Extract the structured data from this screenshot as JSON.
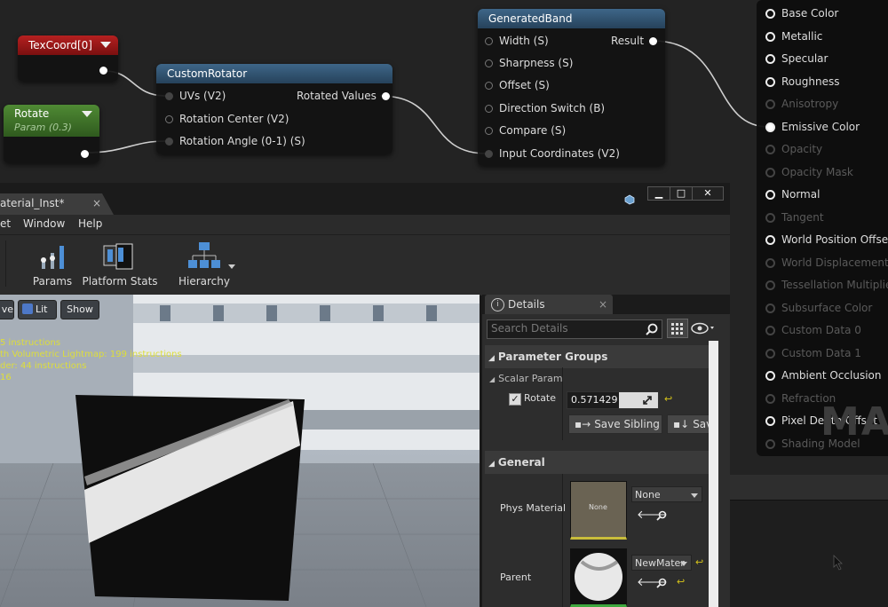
{
  "nodes": {
    "texcoord": {
      "title": "TexCoord[0]"
    },
    "rotate": {
      "title": "Rotate",
      "subtitle": "Param (0.3)"
    },
    "rotator": {
      "title": "CustomRotator",
      "inputs": [
        "UVs (V2)",
        "Rotation Center (V2)",
        "Rotation Angle (0-1) (S)"
      ],
      "output": "Rotated Values"
    },
    "band": {
      "title": "GeneratedBand",
      "inputs": [
        "Width (S)",
        "Sharpness (S)",
        "Offset (S)",
        "Direction Switch (B)",
        "Compare (S)",
        "Input Coordinates (V2)"
      ],
      "output": "Result"
    }
  },
  "result_pins": [
    {
      "label": "Base Color",
      "enabled": true
    },
    {
      "label": "Metallic",
      "enabled": true
    },
    {
      "label": "Specular",
      "enabled": true
    },
    {
      "label": "Roughness",
      "enabled": true
    },
    {
      "label": "Anisotropy",
      "enabled": false
    },
    {
      "label": "Emissive Color",
      "enabled": true
    },
    {
      "label": "Opacity",
      "enabled": false
    },
    {
      "label": "Opacity Mask",
      "enabled": false
    },
    {
      "label": "Normal",
      "enabled": true
    },
    {
      "label": "Tangent",
      "enabled": false
    },
    {
      "label": "World Position Offset",
      "enabled": true
    },
    {
      "label": "World Displacement",
      "enabled": false
    },
    {
      "label": "Tessellation Multiplier",
      "enabled": false
    },
    {
      "label": "Subsurface Color",
      "enabled": false
    },
    {
      "label": "Custom Data 0",
      "enabled": false
    },
    {
      "label": "Custom Data 1",
      "enabled": false
    },
    {
      "label": "Ambient Occlusion",
      "enabled": true
    },
    {
      "label": "Refraction",
      "enabled": false
    },
    {
      "label": "Pixel Depth Offset",
      "enabled": true
    },
    {
      "label": "Shading Model",
      "enabled": false
    }
  ],
  "watermark": "MA",
  "editor": {
    "tab_label": "aterial_Inst*",
    "tab_close": "×",
    "window_buttons": {
      "minimize": "▁",
      "maximize": "□",
      "close": "✕"
    },
    "menu": [
      "et",
      "Window",
      "Help"
    ],
    "toolbar": {
      "params": "Params",
      "platform_stats": "Platform Stats",
      "hierarchy": "Hierarchy"
    },
    "viewport": {
      "buttons": {
        "view": "ve",
        "lit": "Lit",
        "show": "Show"
      },
      "stats": [
        "5 instructions",
        "th Volumetric Lightmap: 199 instructions",
        "der: 44 instructions",
        "16"
      ]
    },
    "details": {
      "tab_label": "Details",
      "tab_close": "×",
      "search_placeholder": "Search Details",
      "parameter_groups": "Parameter Groups",
      "scalar_params": "Scalar Param",
      "rotate_label": "Rotate",
      "rotate_value": "0.571429",
      "rotate_fraction": 0.571429,
      "save_sibling": "Save Sibling",
      "save_child": "Sav",
      "general": "General",
      "phys_material_label": "Phys Material",
      "phys_thumb_text": "None",
      "phys_value": "None",
      "parent_label": "Parent",
      "parent_value": "NewMater"
    }
  }
}
